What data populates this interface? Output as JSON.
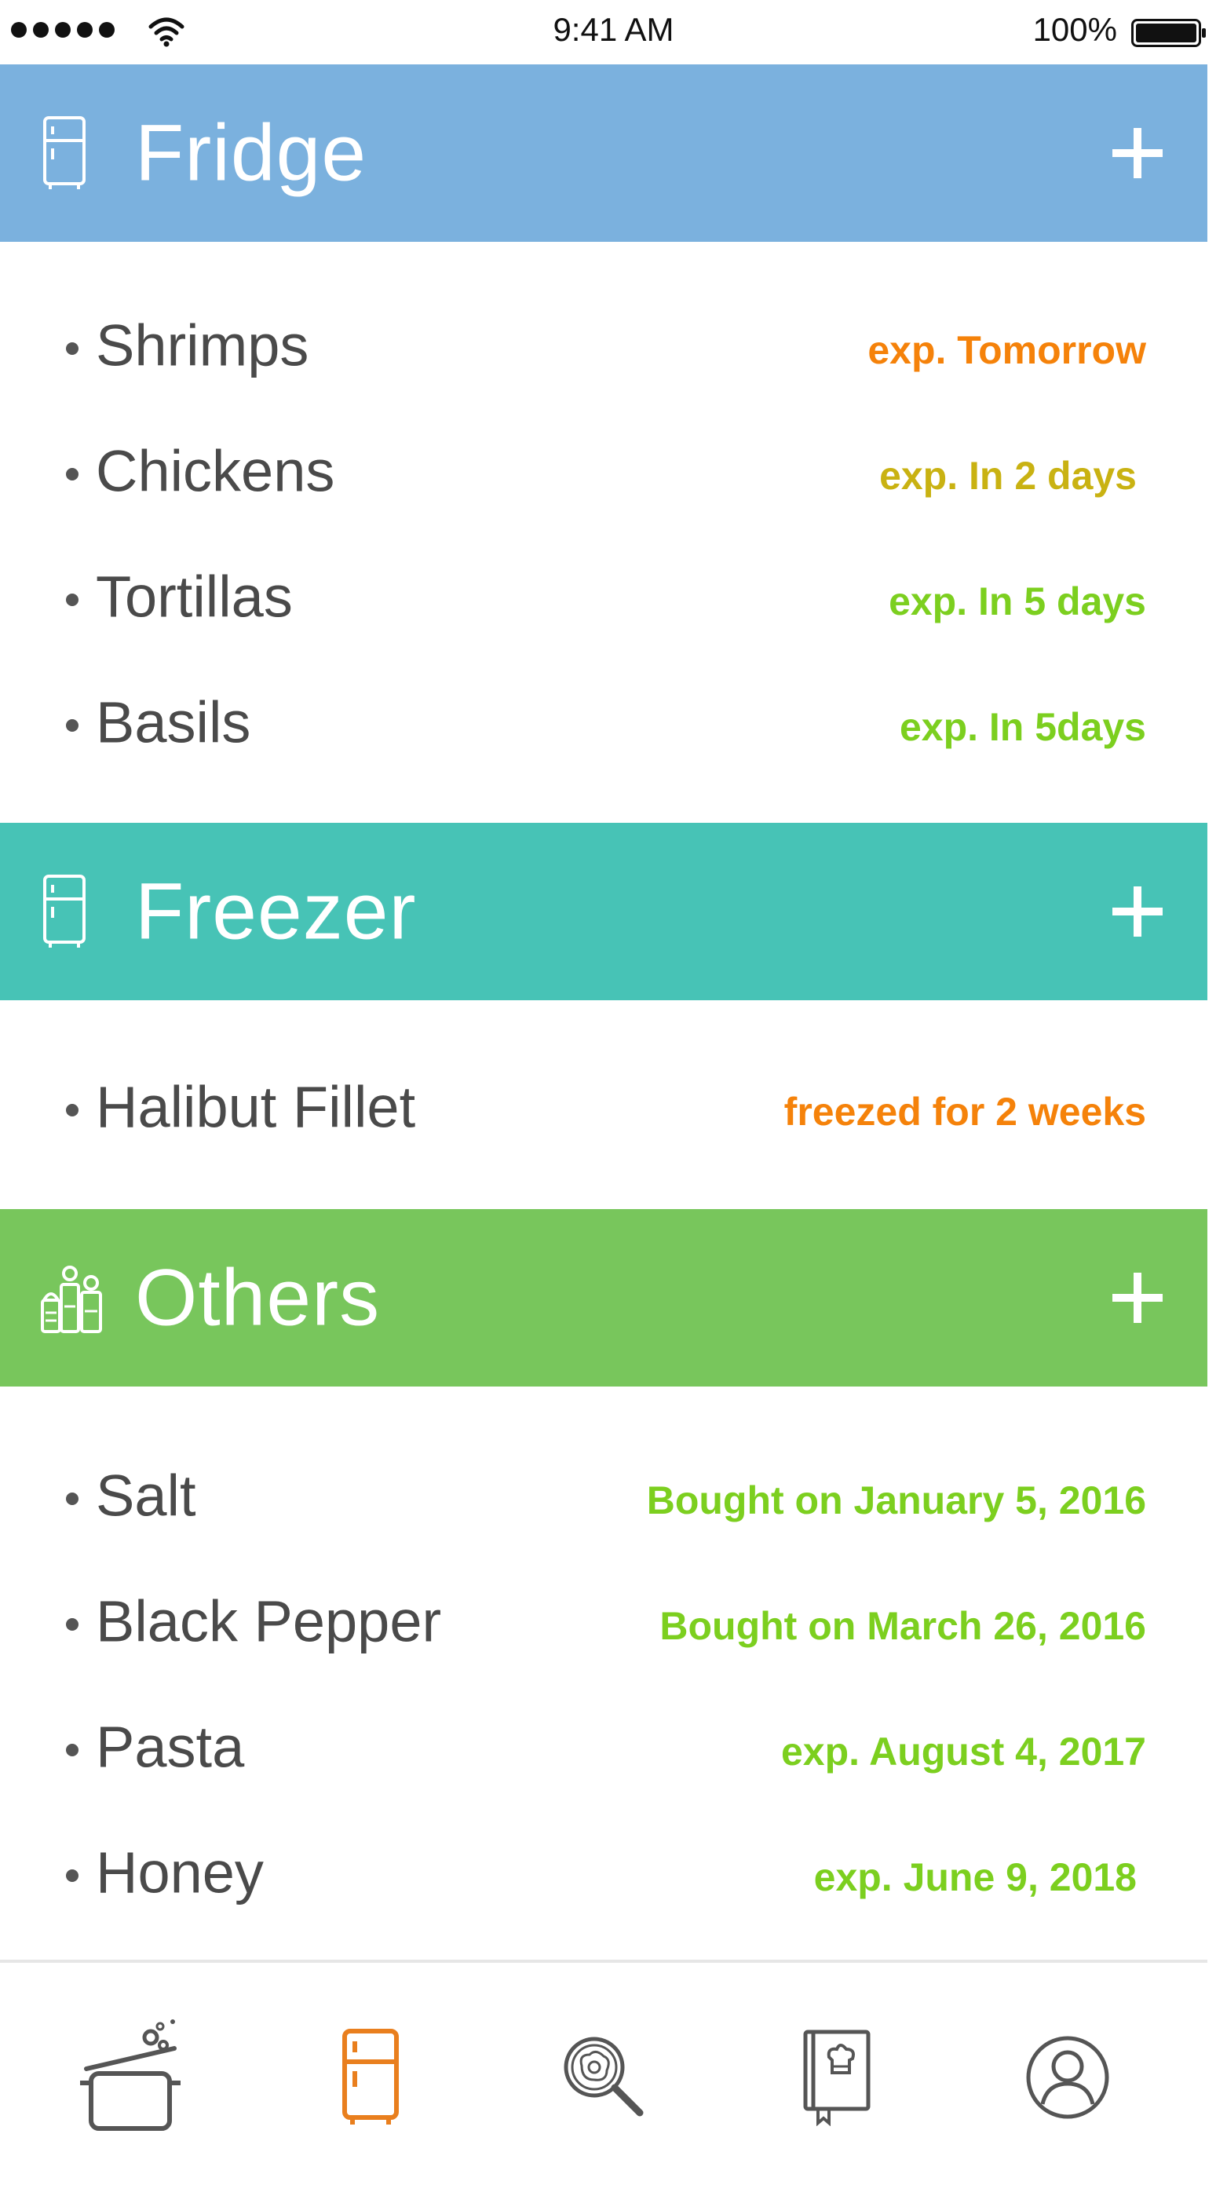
{
  "status_bar": {
    "time": "9:41 AM",
    "battery": "100%"
  },
  "colors": {
    "fridge": "#7bb1de",
    "freezer": "#47c3b6",
    "others": "#78c65c",
    "orange": "#f5820a",
    "yellow": "#c9b212",
    "green": "#7ccf1f",
    "tab_active": "#e97f1e",
    "tab_inactive": "#555555"
  },
  "sections": {
    "fridge": {
      "title": "Fridge",
      "icon": "fridge-icon",
      "items": [
        {
          "name": "Shrimps",
          "status": "exp. Tomorrow",
          "color": "#f5820a"
        },
        {
          "name": "Chickens",
          "status": "exp. In 2 days",
          "color": "#c9b212"
        },
        {
          "name": "Tortillas",
          "status": "exp. In 5 days",
          "color": "#7ccf1f"
        },
        {
          "name": "Basils",
          "status": "exp. In 5days",
          "color": "#7ccf1f"
        }
      ]
    },
    "freezer": {
      "title": "Freezer",
      "icon": "fridge-icon",
      "items": [
        {
          "name": "Halibut Fillet",
          "status": "freezed for 2 weeks",
          "color": "#f5820a"
        }
      ]
    },
    "others": {
      "title": "Others",
      "icon": "spice-jars-icon",
      "items": [
        {
          "name": "Salt",
          "status": "Bought on January 5, 2016",
          "color": "#7ccf1f"
        },
        {
          "name": "Black Pepper",
          "status": "Bought on March 26, 2016",
          "color": "#7ccf1f"
        },
        {
          "name": "Pasta",
          "status": "exp. August 4, 2017",
          "color": "#7ccf1f"
        },
        {
          "name": "Honey",
          "status": "exp. June 9, 2018",
          "color": "#7ccf1f"
        }
      ]
    }
  },
  "tab_bar": {
    "tabs": [
      {
        "icon": "cooking-pot-icon",
        "active": false
      },
      {
        "icon": "fridge-icon",
        "active": true
      },
      {
        "icon": "search-egg-icon",
        "active": false
      },
      {
        "icon": "recipe-book-icon",
        "active": false
      },
      {
        "icon": "profile-icon",
        "active": false
      }
    ]
  }
}
